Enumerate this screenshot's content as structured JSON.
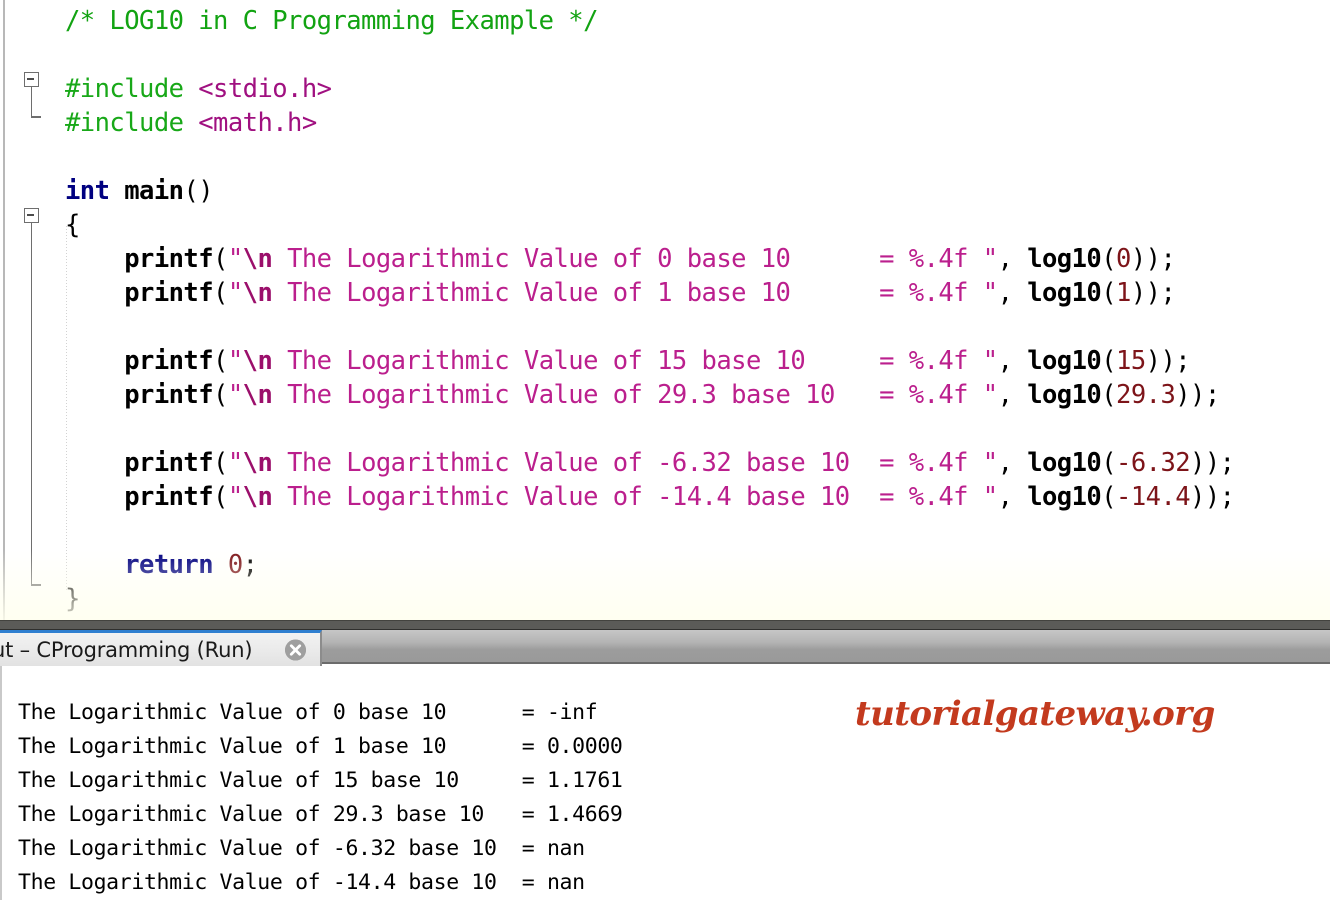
{
  "editor": {
    "language": "c",
    "background": "#ffffff",
    "colors": {
      "comment": "#12a312",
      "preprocessor": "#18a818",
      "header": "#a01080",
      "keyword": "#000080",
      "function": "#000000",
      "string": "#bb1f8d",
      "escape": "#9b0f6b",
      "number": "#7d1419",
      "plain": "#000000"
    },
    "lines": [
      {
        "n": 1,
        "fold": null,
        "segments": [
          {
            "t": "/* LOG10 in C Programming Example */",
            "c": "tok-comment"
          }
        ]
      },
      {
        "n": 2,
        "fold": null,
        "segments": []
      },
      {
        "n": 3,
        "fold": "start",
        "segments": [
          {
            "t": "#include ",
            "c": "tok-pre"
          },
          {
            "t": "<stdio.h>",
            "c": "tok-header"
          }
        ]
      },
      {
        "n": 4,
        "fold": "end",
        "segments": [
          {
            "t": "#include ",
            "c": "tok-pre"
          },
          {
            "t": "<math.h>",
            "c": "tok-header"
          }
        ]
      },
      {
        "n": 5,
        "fold": null,
        "segments": []
      },
      {
        "n": 6,
        "fold": null,
        "segments": [
          {
            "t": "int ",
            "c": "tok-kw"
          },
          {
            "t": "main",
            "c": "tok-fn"
          },
          {
            "t": "()",
            "c": "tok-plain"
          }
        ]
      },
      {
        "n": 7,
        "fold": "start2",
        "segments": [
          {
            "t": "{",
            "c": "tok-plain"
          }
        ]
      },
      {
        "n": 8,
        "fold": null,
        "segments": [
          {
            "t": "    printf",
            "c": "tok-fn"
          },
          {
            "t": "(",
            "c": "tok-plain"
          },
          {
            "t": "\"",
            "c": "tok-str"
          },
          {
            "t": "\\n",
            "c": "tok-esc"
          },
          {
            "t": " The Logarithmic Value of 0 base 10      = %.4f ",
            "c": "tok-str"
          },
          {
            "t": "\"",
            "c": "tok-str"
          },
          {
            "t": ", ",
            "c": "tok-plain"
          },
          {
            "t": "log10",
            "c": "tok-fn"
          },
          {
            "t": "(",
            "c": "tok-plain"
          },
          {
            "t": "0",
            "c": "tok-num"
          },
          {
            "t": "));",
            "c": "tok-plain"
          }
        ]
      },
      {
        "n": 9,
        "fold": null,
        "segments": [
          {
            "t": "    printf",
            "c": "tok-fn"
          },
          {
            "t": "(",
            "c": "tok-plain"
          },
          {
            "t": "\"",
            "c": "tok-str"
          },
          {
            "t": "\\n",
            "c": "tok-esc"
          },
          {
            "t": " The Logarithmic Value of 1 base 10      = %.4f ",
            "c": "tok-str"
          },
          {
            "t": "\"",
            "c": "tok-str"
          },
          {
            "t": ", ",
            "c": "tok-plain"
          },
          {
            "t": "log10",
            "c": "tok-fn"
          },
          {
            "t": "(",
            "c": "tok-plain"
          },
          {
            "t": "1",
            "c": "tok-num"
          },
          {
            "t": "));",
            "c": "tok-plain"
          }
        ]
      },
      {
        "n": 10,
        "fold": null,
        "segments": []
      },
      {
        "n": 11,
        "fold": null,
        "segments": [
          {
            "t": "    printf",
            "c": "tok-fn"
          },
          {
            "t": "(",
            "c": "tok-plain"
          },
          {
            "t": "\"",
            "c": "tok-str"
          },
          {
            "t": "\\n",
            "c": "tok-esc"
          },
          {
            "t": " The Logarithmic Value of 15 base 10     = %.4f ",
            "c": "tok-str"
          },
          {
            "t": "\"",
            "c": "tok-str"
          },
          {
            "t": ", ",
            "c": "tok-plain"
          },
          {
            "t": "log10",
            "c": "tok-fn"
          },
          {
            "t": "(",
            "c": "tok-plain"
          },
          {
            "t": "15",
            "c": "tok-num"
          },
          {
            "t": "));",
            "c": "tok-plain"
          }
        ]
      },
      {
        "n": 12,
        "fold": null,
        "segments": [
          {
            "t": "    printf",
            "c": "tok-fn"
          },
          {
            "t": "(",
            "c": "tok-plain"
          },
          {
            "t": "\"",
            "c": "tok-str"
          },
          {
            "t": "\\n",
            "c": "tok-esc"
          },
          {
            "t": " The Logarithmic Value of 29.3 base 10   = %.4f ",
            "c": "tok-str"
          },
          {
            "t": "\"",
            "c": "tok-str"
          },
          {
            "t": ", ",
            "c": "tok-plain"
          },
          {
            "t": "log10",
            "c": "tok-fn"
          },
          {
            "t": "(",
            "c": "tok-plain"
          },
          {
            "t": "29.3",
            "c": "tok-num"
          },
          {
            "t": "));",
            "c": "tok-plain"
          }
        ]
      },
      {
        "n": 13,
        "fold": null,
        "segments": []
      },
      {
        "n": 14,
        "fold": null,
        "segments": [
          {
            "t": "    printf",
            "c": "tok-fn"
          },
          {
            "t": "(",
            "c": "tok-plain"
          },
          {
            "t": "\"",
            "c": "tok-str"
          },
          {
            "t": "\\n",
            "c": "tok-esc"
          },
          {
            "t": " The Logarithmic Value of -6.32 base 10  = %.4f ",
            "c": "tok-str"
          },
          {
            "t": "\"",
            "c": "tok-str"
          },
          {
            "t": ", ",
            "c": "tok-plain"
          },
          {
            "t": "log10",
            "c": "tok-fn"
          },
          {
            "t": "(",
            "c": "tok-plain"
          },
          {
            "t": "-6.32",
            "c": "tok-num"
          },
          {
            "t": "));",
            "c": "tok-plain"
          }
        ]
      },
      {
        "n": 15,
        "fold": null,
        "segments": [
          {
            "t": "    printf",
            "c": "tok-fn"
          },
          {
            "t": "(",
            "c": "tok-plain"
          },
          {
            "t": "\"",
            "c": "tok-str"
          },
          {
            "t": "\\n",
            "c": "tok-esc"
          },
          {
            "t": " The Logarithmic Value of -14.4 base 10  = %.4f ",
            "c": "tok-str"
          },
          {
            "t": "\"",
            "c": "tok-str"
          },
          {
            "t": ", ",
            "c": "tok-plain"
          },
          {
            "t": "log10",
            "c": "tok-fn"
          },
          {
            "t": "(",
            "c": "tok-plain"
          },
          {
            "t": "-14.4",
            "c": "tok-num"
          },
          {
            "t": "));",
            "c": "tok-plain"
          }
        ]
      },
      {
        "n": 16,
        "fold": null,
        "segments": []
      },
      {
        "n": 17,
        "fold": null,
        "segments": [
          {
            "t": "    return ",
            "c": "tok-kw"
          },
          {
            "t": "0",
            "c": "tok-num"
          },
          {
            "t": ";",
            "c": "tok-plain"
          }
        ]
      },
      {
        "n": 18,
        "fold": "end2",
        "segments": [
          {
            "t": "}",
            "c": "tok-plain"
          }
        ]
      }
    ]
  },
  "output_window": {
    "tab": {
      "label": "ut – CProgramming (Run)",
      "full_label": "Output – CProgramming (Run)",
      "truncated_left": true,
      "active": true,
      "accent_color": "#2f7fd0",
      "close_icon": "close-circle-icon"
    },
    "console_lines": [
      "The Logarithmic Value of 0 base 10      = -inf",
      "The Logarithmic Value of 1 base 10      = 0.0000",
      "The Logarithmic Value of 15 base 10     = 1.1761",
      "The Logarithmic Value of 29.3 base 10   = 1.4669",
      "The Logarithmic Value of -6.32 base 10  = nan",
      "The Logarithmic Value of -14.4 base 10  = nan"
    ],
    "results": [
      {
        "input": "0",
        "base": "10",
        "value": "-inf"
      },
      {
        "input": "1",
        "base": "10",
        "value": "0.0000"
      },
      {
        "input": "15",
        "base": "10",
        "value": "1.1761"
      },
      {
        "input": "29.3",
        "base": "10",
        "value": "1.4669"
      },
      {
        "input": "-6.32",
        "base": "10",
        "value": "nan"
      },
      {
        "input": "-14.4",
        "base": "10",
        "value": "nan"
      }
    ]
  },
  "watermark": {
    "text": "tutorialgateway.org",
    "color": "#c33a1e"
  }
}
